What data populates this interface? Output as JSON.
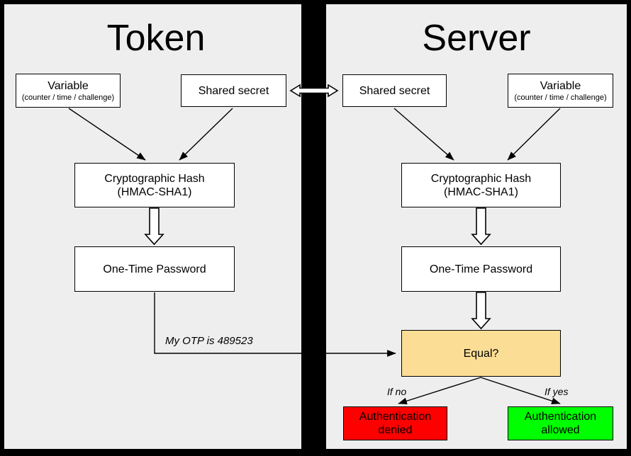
{
  "diagram": {
    "title_left": "Token",
    "title_right": "Server",
    "background": "#EEEEEE",
    "divider_color": "#000000"
  },
  "token": {
    "variable": {
      "line1": "Variable",
      "line2": "(counter / time / challenge)"
    },
    "shared_secret": {
      "line1": "Shared secret"
    },
    "hash": {
      "line1": "Cryptographic Hash",
      "line2": "(HMAC-SHA1)"
    },
    "otp": {
      "line1": "One-Time Password"
    }
  },
  "server": {
    "shared_secret": {
      "line1": "Shared secret"
    },
    "variable": {
      "line1": "Variable",
      "line2": "(counter / time / challenge)"
    },
    "hash": {
      "line1": "Cryptographic Hash",
      "line2": "(HMAC-SHA1)"
    },
    "otp": {
      "line1": "One-Time Password"
    },
    "equal": {
      "line1": "Equal?",
      "color": "#FBDD96"
    },
    "denied": {
      "line1": "Authentication",
      "line2": "denied",
      "color": "#FF0000"
    },
    "allowed": {
      "line1": "Authentication",
      "line2": "allowed",
      "color": "#00FF00"
    }
  },
  "edges": {
    "otp_message": "My OTP is 489523",
    "if_no": "If no",
    "if_yes": "If yes"
  }
}
